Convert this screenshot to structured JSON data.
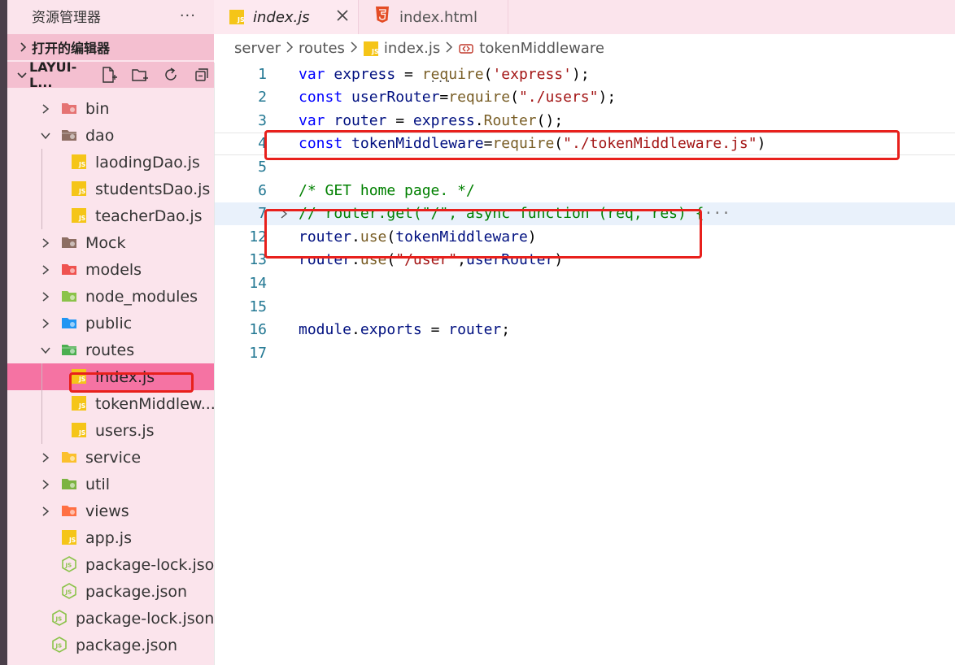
{
  "sidebar": {
    "title": "资源管理器",
    "more": "···",
    "open_editors": "打开的编辑器",
    "workspace": "LAYUI-L...",
    "tree": [
      {
        "label": "bin",
        "type": "folder",
        "icon": "folder-bin-icon",
        "color": "#e57373",
        "expanded": false,
        "depth": 1
      },
      {
        "label": "dao",
        "type": "folder",
        "icon": "folder-dao-icon",
        "color": "#8d6e63",
        "expanded": true,
        "depth": 1
      },
      {
        "label": "laodingDao.js",
        "type": "file",
        "icon": "js-file-icon",
        "color": "#f5c518",
        "depth": 2
      },
      {
        "label": "studentsDao.js",
        "type": "file",
        "icon": "js-file-icon",
        "color": "#f5c518",
        "depth": 2
      },
      {
        "label": "teacherDao.js",
        "type": "file",
        "icon": "js-file-icon",
        "color": "#f5c518",
        "depth": 2
      },
      {
        "label": "Mock",
        "type": "folder",
        "icon": "folder-mock-icon",
        "color": "#8d6e63",
        "expanded": false,
        "depth": 1
      },
      {
        "label": "models",
        "type": "folder",
        "icon": "folder-models-icon",
        "color": "#ef5350",
        "expanded": false,
        "depth": 1
      },
      {
        "label": "node_modules",
        "type": "folder",
        "icon": "folder-node-icon",
        "color": "#8bc34a",
        "expanded": false,
        "depth": 1
      },
      {
        "label": "public",
        "type": "folder",
        "icon": "folder-public-icon",
        "color": "#2196f3",
        "expanded": false,
        "depth": 1
      },
      {
        "label": "routes",
        "type": "folder",
        "icon": "folder-routes-icon",
        "color": "#4caf50",
        "expanded": true,
        "depth": 1
      },
      {
        "label": "index.js",
        "type": "file",
        "icon": "js-file-icon",
        "color": "#f5c518",
        "depth": 2,
        "selected": true
      },
      {
        "label": "tokenMiddlew...",
        "type": "file",
        "icon": "js-file-icon",
        "color": "#f5c518",
        "depth": 2
      },
      {
        "label": "users.js",
        "type": "file",
        "icon": "js-file-icon",
        "color": "#f5c518",
        "depth": 2
      },
      {
        "label": "service",
        "type": "folder",
        "icon": "folder-service-icon",
        "color": "#fbc02d",
        "expanded": false,
        "depth": 1
      },
      {
        "label": "util",
        "type": "folder",
        "icon": "folder-util-icon",
        "color": "#7cb342",
        "expanded": false,
        "depth": 1
      },
      {
        "label": "views",
        "type": "folder",
        "icon": "folder-views-icon",
        "color": "#ff7043",
        "expanded": false,
        "depth": 1
      },
      {
        "label": "app.js",
        "type": "file",
        "icon": "js-file-icon",
        "color": "#f5c518",
        "depth": 1
      },
      {
        "label": "package-lock.json",
        "type": "file",
        "icon": "node-json-icon",
        "color": "#8bc34a",
        "depth": 1
      },
      {
        "label": "package.json",
        "type": "file",
        "icon": "node-json-icon",
        "color": "#8bc34a",
        "depth": 1
      },
      {
        "label": "package-lock.json",
        "type": "file",
        "icon": "node-json-icon",
        "color": "#8bc34a",
        "depth": 0
      },
      {
        "label": "package.json",
        "type": "file",
        "icon": "node-json-icon",
        "color": "#8bc34a",
        "depth": 0
      }
    ]
  },
  "tabs": [
    {
      "label": "index.js",
      "icon": "js-file-icon",
      "active": true
    },
    {
      "label": "index.html",
      "icon": "html5-icon",
      "active": false
    }
  ],
  "breadcrumb": [
    "server",
    "routes",
    "index.js",
    "tokenMiddleware"
  ],
  "editor": {
    "hint": "···",
    "lines": [
      {
        "n": "1",
        "tokens": [
          [
            "kw",
            "var"
          ],
          [
            "pn",
            " "
          ],
          [
            "id",
            "express"
          ],
          [
            "pn",
            " = "
          ],
          [
            "fn",
            "require"
          ],
          [
            "pn",
            "("
          ],
          [
            "str",
            "'express'"
          ],
          [
            "pn",
            ");"
          ]
        ]
      },
      {
        "n": "2",
        "tokens": [
          [
            "kw",
            "const"
          ],
          [
            "pn",
            " "
          ],
          [
            "id",
            "userRouter"
          ],
          [
            "pn",
            "="
          ],
          [
            "fn",
            "require"
          ],
          [
            "pn",
            "("
          ],
          [
            "str",
            "\"./users\""
          ],
          [
            "pn",
            ");"
          ]
        ]
      },
      {
        "n": "3",
        "tokens": [
          [
            "kw",
            "var"
          ],
          [
            "pn",
            " "
          ],
          [
            "id",
            "router"
          ],
          [
            "pn",
            " = "
          ],
          [
            "id",
            "express"
          ],
          [
            "pn",
            "."
          ],
          [
            "fn",
            "Router"
          ],
          [
            "pn",
            "();"
          ]
        ]
      },
      {
        "n": "4",
        "tokens": [
          [
            "kw",
            "const"
          ],
          [
            "pn",
            " "
          ],
          [
            "id",
            "tokenMiddleware"
          ],
          [
            "pn",
            "="
          ],
          [
            "fn",
            "require"
          ],
          [
            "pn",
            "("
          ],
          [
            "str",
            "\"./tokenMiddleware.js\""
          ],
          [
            "pn",
            ")"
          ]
        ]
      },
      {
        "n": "5",
        "tokens": []
      },
      {
        "n": "6",
        "tokens": [
          [
            "cm",
            "/* GET home page. */"
          ]
        ]
      },
      {
        "n": "7",
        "folded": true,
        "tokens": [
          [
            "cm",
            "// router.get(\"/\", async function (req, res) {"
          ],
          [
            "ellipsis",
            "···"
          ]
        ]
      },
      {
        "n": "12",
        "tokens": [
          [
            "id",
            "router"
          ],
          [
            "pn",
            "."
          ],
          [
            "fn",
            "use"
          ],
          [
            "pn",
            "("
          ],
          [
            "id",
            "tokenMiddleware"
          ],
          [
            "pn",
            ")"
          ]
        ]
      },
      {
        "n": "13",
        "tokens": [
          [
            "id",
            "router"
          ],
          [
            "pn",
            "."
          ],
          [
            "fn",
            "use"
          ],
          [
            "pn",
            "("
          ],
          [
            "str",
            "\"/user\""
          ],
          [
            "pn",
            ","
          ],
          [
            "id",
            "userRouter"
          ],
          [
            "pn",
            ")"
          ]
        ]
      },
      {
        "n": "14",
        "tokens": []
      },
      {
        "n": "15",
        "tokens": []
      },
      {
        "n": "16",
        "tokens": [
          [
            "id",
            "module"
          ],
          [
            "pn",
            "."
          ],
          [
            "id",
            "exports"
          ],
          [
            "pn",
            " = "
          ],
          [
            "id",
            "router"
          ],
          [
            "pn",
            ";"
          ]
        ]
      },
      {
        "n": "17",
        "tokens": []
      }
    ]
  },
  "colors": {
    "sidebar_bg": "#fbe4ec",
    "section_header_bg": "#f4bfd0",
    "selected_row": "#f573a3",
    "annotation_red": "#e8201c"
  }
}
